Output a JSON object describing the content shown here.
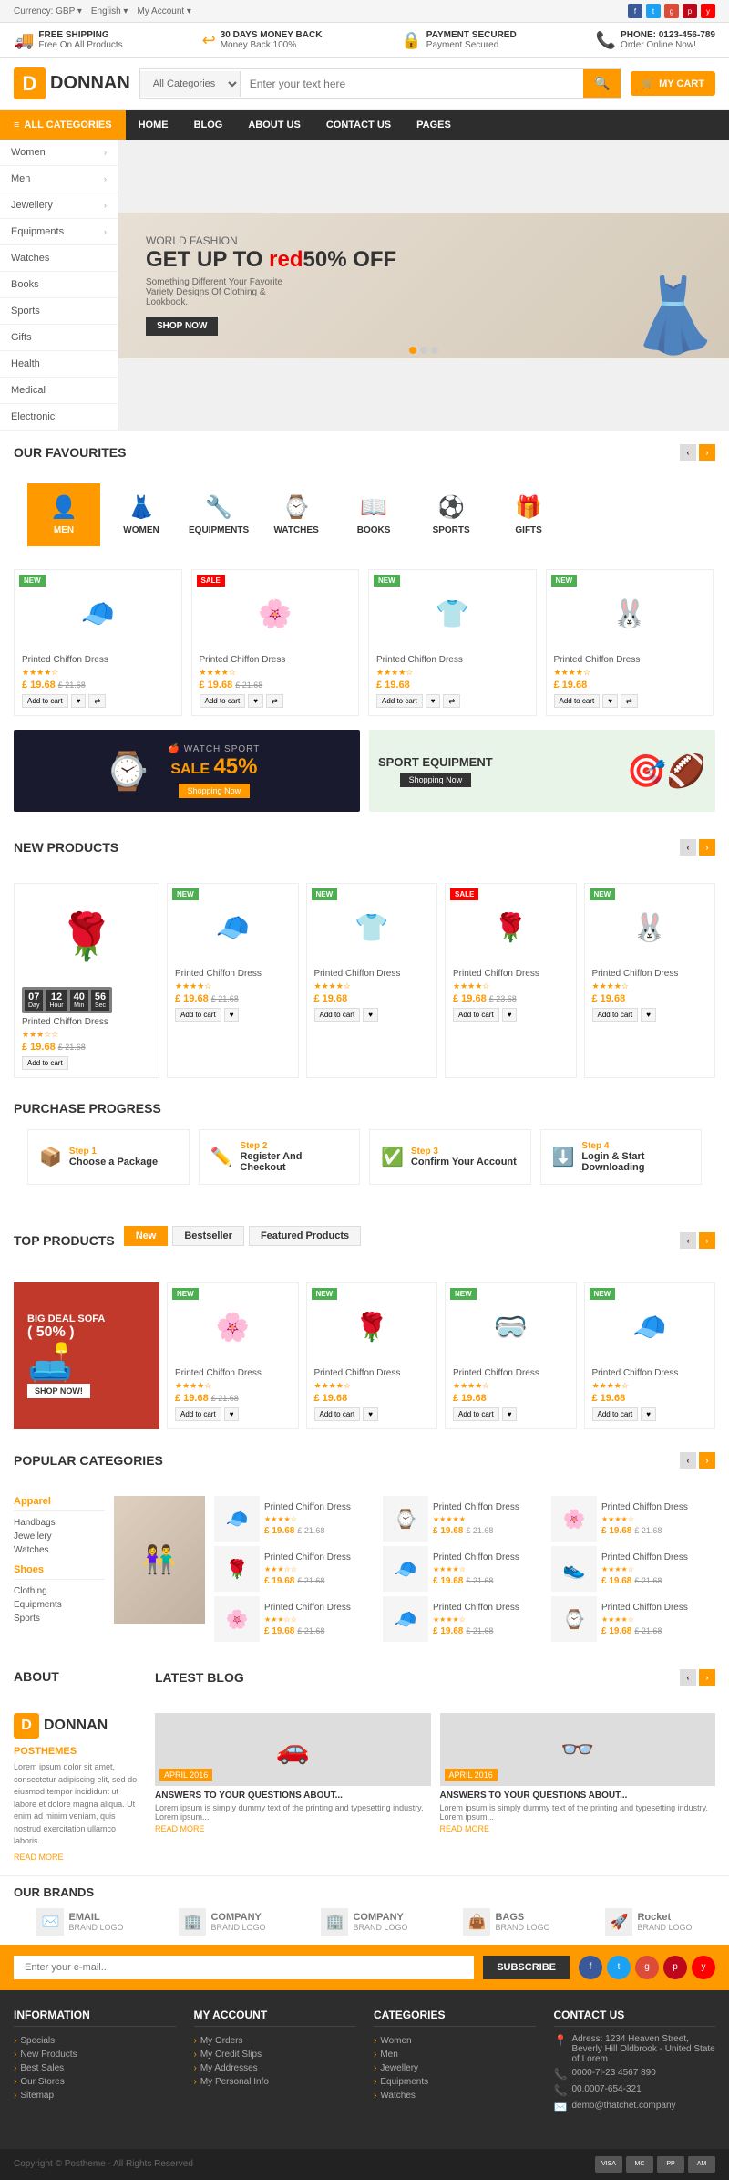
{
  "topBar": {
    "currency": "Currency: GBP ▾",
    "language": "English ▾",
    "account": "My Account ▾",
    "socials": [
      "f",
      "t",
      "g+",
      "p",
      "y"
    ]
  },
  "infoBar": {
    "items": [
      {
        "icon": "🚚",
        "title": "FREE SHIPPING",
        "sub": "Free On All Products"
      },
      {
        "icon": "↩",
        "title": "30 DAYS MONEY BACK",
        "sub": "Money Back 100%"
      },
      {
        "icon": "🔒",
        "title": "PAYMENT SECURED",
        "sub": "Payment Secured"
      },
      {
        "icon": "📞",
        "title": "PHONE: 0123-456-789",
        "sub": "Order Online Now!"
      }
    ]
  },
  "header": {
    "logo": "DONNAN",
    "logoD": "D",
    "categoryPlaceholder": "All Categories",
    "searchPlaceholder": "Enter your text here",
    "cartLabel": "MY CART",
    "cartIcon": "🛒"
  },
  "nav": {
    "allCategories": "≡ ALL CATEGORIES",
    "links": [
      "HOME",
      "BLOG",
      "ABOUT US",
      "CONTACT US",
      "PAGES"
    ]
  },
  "sidebar": {
    "items": [
      {
        "label": "Women",
        "hasArrow": true
      },
      {
        "label": "Men",
        "hasArrow": true
      },
      {
        "label": "Jewellery",
        "hasArrow": true
      },
      {
        "label": "Equipments",
        "hasArrow": true
      },
      {
        "label": "Watches",
        "hasArrow": false
      },
      {
        "label": "Books",
        "hasArrow": false
      },
      {
        "label": "Sports",
        "hasArrow": false
      },
      {
        "label": "Gifts",
        "hasArrow": false
      },
      {
        "label": "Health",
        "hasArrow": false
      },
      {
        "label": "Medical",
        "hasArrow": false
      },
      {
        "label": "Electronic",
        "hasArrow": false
      }
    ]
  },
  "hero": {
    "subtitle": "WORLD FASHION",
    "title": "GET UP TO 50% OFF",
    "titleColor": "red",
    "desc": "Something Different Your Favorite Variety Designs Of Clothing & Lookbook.",
    "btnLabel": "SHOP NOW"
  },
  "favourites": {
    "title": "OUR FAVOURITES",
    "items": [
      {
        "icon": "👤",
        "label": "MEN",
        "active": true
      },
      {
        "icon": "👗",
        "label": "WOMEN",
        "active": false
      },
      {
        "icon": "🔧",
        "label": "EQUIPMENTS",
        "active": false
      },
      {
        "icon": "⌚",
        "label": "WATCHES",
        "active": false
      },
      {
        "icon": "📖",
        "label": "BOOKS",
        "active": false
      },
      {
        "icon": "⚽",
        "label": "SPORTS",
        "active": false
      },
      {
        "icon": "🎁",
        "label": "GIFTS",
        "active": false
      }
    ]
  },
  "products": {
    "favProducts": [
      {
        "name": "Printed Chiffon Dress",
        "price": "£ 19.68",
        "oldPrice": "£ 21.68",
        "stars": "★★★★☆",
        "badge": "NEW",
        "badgeType": "new",
        "icon": "🧢"
      },
      {
        "name": "Printed Chiffon Dress",
        "price": "£ 19.68",
        "oldPrice": "£ 21.68",
        "stars": "★★★★☆",
        "badge": "SALE",
        "badgeType": "sale",
        "icon": "🌸"
      },
      {
        "name": "Printed Chiffon Dress",
        "price": "£ 19.68",
        "oldPrice": "",
        "stars": "★★★★☆",
        "badge": "NEW",
        "badgeType": "new",
        "icon": "👕"
      },
      {
        "name": "Printed Chiffon Dress",
        "price": "£ 19.68",
        "oldPrice": "",
        "stars": "★★★★☆",
        "badge": "NEW",
        "badgeType": "new",
        "icon": "🐰"
      }
    ]
  },
  "banners": {
    "left": {
      "title": "WATCH SPORT",
      "sale": "SALE 45%",
      "btn": "Shopping Now"
    },
    "right": {
      "title": "SPORT EQUIPMENT",
      "btn": "Shopping Now"
    }
  },
  "newProducts": {
    "title": "NEW PRODUCTS",
    "featured": {
      "name": "Printed Chiffon Dress",
      "price": "£ 19.68",
      "oldPrice": "£ 21.68",
      "stars": "★★★☆☆",
      "icon": "🌹",
      "countdown": {
        "days": "07",
        "hours": "12",
        "min": "40",
        "sec": "56"
      }
    },
    "items": [
      {
        "name": "Printed Chiffon Dress",
        "price": "£ 19.68",
        "oldPrice": "£ 21.68",
        "stars": "★★★★☆",
        "badge": "NEW",
        "icon": "🧢"
      },
      {
        "name": "Printed Chiffon Dress",
        "price": "£ 19.68",
        "oldPrice": "",
        "stars": "★★★★☆",
        "badge": "NEW",
        "icon": "👕"
      },
      {
        "name": "Printed Chiffon Dress",
        "price": "£ 19.68",
        "oldPrice": "£ 23.68",
        "stars": "★★★★☆",
        "badge": "SALE",
        "icon": "🌹"
      },
      {
        "name": "Printed Chiffon Dress",
        "price": "£ 19.68",
        "oldPrice": "",
        "stars": "★★★★☆",
        "badge": "NEW",
        "icon": "🐰"
      }
    ]
  },
  "purchaseProgress": {
    "title": "PURCHASE PROGRESS",
    "steps": [
      {
        "num": "Step 1",
        "name": "Choose a Package",
        "icon": "📦"
      },
      {
        "num": "Step 2",
        "name": "Register And Checkout",
        "icon": "✏️"
      },
      {
        "num": "Step 3",
        "name": "Confirm Your Account",
        "icon": "✅"
      },
      {
        "num": "Step 4",
        "name": "Login & Start Downloading",
        "icon": "⬇️"
      }
    ]
  },
  "topProducts": {
    "title": "TOP PRODUCTS",
    "tabs": [
      "New",
      "Bestseller",
      "Featured Products"
    ],
    "featured": {
      "title": "BIG DEAL SOFA",
      "discount": "( 50% )",
      "btn": "SHOP NOW!",
      "icon": "🛋️"
    },
    "items": [
      {
        "name": "Printed Chiffon Dress",
        "price": "£ 19.68",
        "oldPrice": "£ 21.68",
        "stars": "★★★★☆",
        "badge": "NEW",
        "icon": "🌸"
      },
      {
        "name": "Printed Chiffon Dress",
        "price": "£ 19.68",
        "oldPrice": "",
        "stars": "★★★★☆",
        "badge": "NEW",
        "icon": "🌹"
      },
      {
        "name": "Printed Chiffon Dress",
        "price": "£ 19.68",
        "oldPrice": "",
        "stars": "★★★★☆",
        "badge": "NEW",
        "icon": "🥽"
      },
      {
        "name": "Printed Chiffon Dress",
        "price": "£ 19.68",
        "oldPrice": "",
        "stars": "★★★★☆",
        "badge": "NEW",
        "icon": "🧢"
      }
    ]
  },
  "popularCategories": {
    "title": "POPULAR CATEGORIES",
    "lists": [
      {
        "title": "Apparel",
        "items": [
          "Handbags",
          "Jewellery",
          "Watches"
        ]
      },
      {
        "title": "Shoes",
        "items": [
          "Clothing",
          "Equipments",
          "Sports"
        ]
      }
    ],
    "products": [
      {
        "name": "Printed Chiffon Dress",
        "price": "£ 19.68",
        "oldPrice": "£ 21.68",
        "stars": "★★★★☆",
        "icon": "🧢"
      },
      {
        "name": "Printed Chiffon Dress",
        "price": "£ 19.68",
        "oldPrice": "£ 21.68",
        "stars": "★★★★★",
        "icon": "⌚"
      },
      {
        "name": "Printed Chiffon Dress",
        "price": "£ 19.68",
        "oldPrice": "£ 21.68",
        "stars": "★★★★☆",
        "icon": "🌸"
      },
      {
        "name": "Printed Chiffon Dress",
        "price": "£ 19.68",
        "oldPrice": "£ 21.68",
        "stars": "★★★☆☆",
        "icon": "🌹"
      },
      {
        "name": "Printed Chiffon Dress",
        "price": "£ 19.68",
        "oldPrice": "£ 21.68",
        "stars": "★★★★☆",
        "icon": "🧢"
      },
      {
        "name": "Printed Chiffon Dress",
        "price": "£ 19.68",
        "oldPrice": "£ 21.68",
        "stars": "★★★★☆",
        "icon": "👟"
      },
      {
        "name": "Printed Chiffon Dress",
        "price": "£ 19.68",
        "oldPrice": "£ 21.68",
        "stars": "★★★☆☆",
        "icon": "🌸"
      },
      {
        "name": "Printed Chiffon Dress",
        "price": "£ 19.68",
        "oldPrice": "£ 21.68",
        "stars": "★★★★☆",
        "icon": "🧢"
      },
      {
        "name": "Printed Chiffon Dress",
        "price": "£ 19.68",
        "oldPrice": "£ 21.68",
        "stars": "★★★★☆",
        "icon": "⌚"
      }
    ]
  },
  "about": {
    "title": "ABOUT",
    "logo": "DONNAN",
    "logoD": "D",
    "brand": "POSTHEMES",
    "desc": "Lorem ipsum dolor sit amet, consectetur adipiscing elit, sed do eiusmod tempor incididunt ut labore et dolore magna aliqua. Ut enim ad minim veniam, quis nostrud exercitation ullamco laboris.",
    "readMore": "READ MORE"
  },
  "blog": {
    "title": "LATEST BLOG",
    "posts": [
      {
        "date": "APRIL 2016",
        "title": "ANSWERS TO YOUR QUESTIONS ABOUT...",
        "text": "Lorem ipsum is simply dummy text of the printing and typesetting industry. Lorem ipsum...",
        "readMore": "READ MORE",
        "icon": "🚗"
      },
      {
        "date": "APRIL 2016",
        "title": "ANSWERS TO YOUR QUESTIONS ABOUT...",
        "text": "Lorem ipsum is simply dummy text of the printing and typesetting industry. Lorem ipsum...",
        "readMore": "READ MORE",
        "icon": "👓"
      }
    ]
  },
  "brands": {
    "title": "OUR BRANDS",
    "items": [
      {
        "icon": "✉️",
        "line1": "EMAIL",
        "line2": "BRAND LOGO"
      },
      {
        "icon": "🏢",
        "line1": "COMPANY",
        "line2": "BRAND LOGO"
      },
      {
        "icon": "🏢",
        "line1": "COMPANY",
        "line2": "BRAND LOGO"
      },
      {
        "icon": "👜",
        "line1": "BAGS",
        "line2": "BRAND LOGO"
      },
      {
        "icon": "🚀",
        "line1": "Rocket",
        "line2": "BRAND LOGO"
      }
    ]
  },
  "newsletter": {
    "placeholder": "Enter your e-mail...",
    "btnLabel": "SUBSCRIBE",
    "socials": [
      {
        "icon": "f",
        "color": "#3b5998"
      },
      {
        "icon": "t",
        "color": "#1da1f2"
      },
      {
        "icon": "g",
        "color": "#dd4b39"
      },
      {
        "icon": "p",
        "color": "#bd081c"
      },
      {
        "icon": "y",
        "color": "#ff0000"
      }
    ]
  },
  "footer": {
    "cols": [
      {
        "title": "INFORMATION",
        "items": [
          "Specials",
          "New Products",
          "Best Sales",
          "Our Stores",
          "Sitemap"
        ]
      },
      {
        "title": "MY ACCOUNT",
        "items": [
          "My Orders",
          "My Credit Slips",
          "My Addresses",
          "My Personal Info"
        ]
      },
      {
        "title": "CATEGORIES",
        "items": [
          "Women",
          "Men",
          "Jewellery",
          "Equipments",
          "Watches"
        ]
      },
      {
        "title": "CONTACT US",
        "address": "Adress: 1234 Heaven Street, Beverly Hill Oldbrook - United State of Lorem",
        "phones": [
          "0000-7l-23 4567 890",
          "00.0007-654-321"
        ],
        "email": "demo@thatchet.company"
      }
    ],
    "copyright": "Copyright © Postheme - All Rights Reserved",
    "payments": [
      "VISA",
      "MC",
      "PP",
      "AM"
    ]
  }
}
